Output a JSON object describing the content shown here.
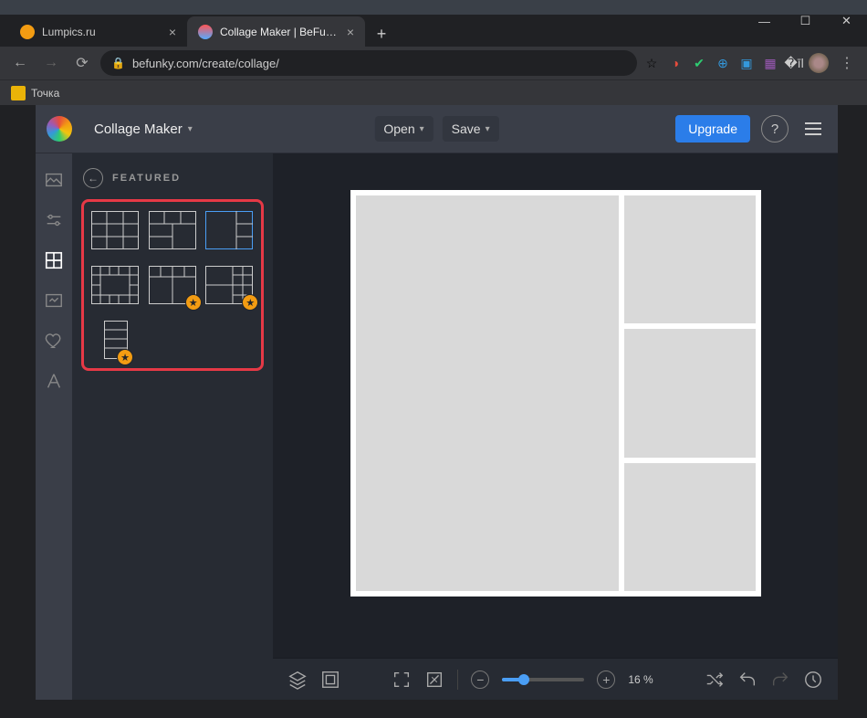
{
  "browser": {
    "tabs": [
      {
        "title": "Lumpics.ru",
        "favicon": "#f39c12"
      },
      {
        "title": "Collage Maker | BeFunky: Create",
        "favicon": "#fff"
      }
    ],
    "url": "befunky.com/create/collage/",
    "bookmark": "Точка"
  },
  "app": {
    "mode": "Collage Maker",
    "menu_open": "Open",
    "menu_save": "Save",
    "upgrade": "Upgrade"
  },
  "panel": {
    "title": "FEATURED"
  },
  "zoom": {
    "pct": "16 %"
  }
}
